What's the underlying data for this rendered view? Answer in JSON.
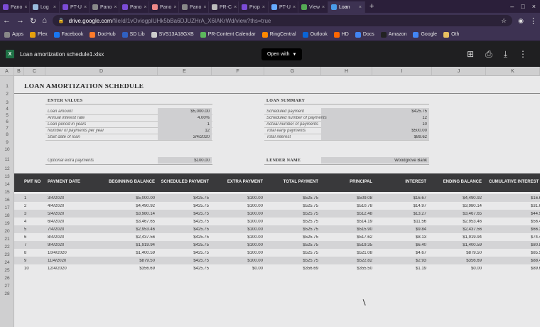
{
  "browser": {
    "tabs": [
      {
        "title": "Pano",
        "color": "#7b4bd6"
      },
      {
        "title": "Log",
        "color": "#9bd"
      },
      {
        "title": "PT-U",
        "color": "#7b4bd6"
      },
      {
        "title": "Pano",
        "color": "#888"
      },
      {
        "title": "Pano",
        "color": "#7b4bd6"
      },
      {
        "title": "Pano",
        "color": "#e88"
      },
      {
        "title": "Pano",
        "color": "#888"
      },
      {
        "title": "PR-C",
        "color": "#bbb"
      },
      {
        "title": "Prop",
        "color": "#7b4bd6"
      },
      {
        "title": "PT-U",
        "color": "#6af"
      },
      {
        "title": "View",
        "color": "#5a5"
      },
      {
        "title": "Loan",
        "color": "#4a9be8",
        "active": true
      }
    ],
    "new_tab_symbol": "+",
    "url_host": "drive.google.com",
    "url_path": "/file/d/1vOviogpIUHk5bBa6DJUZHrA_X6IAKrWd/view?ths=true",
    "bookmarks": [
      {
        "label": "Apps",
        "color": "#888"
      },
      {
        "label": "Plex",
        "color": "#e5a00d"
      },
      {
        "label": "Facebook",
        "color": "#1877f2"
      },
      {
        "label": "DocHub",
        "color": "#ff7b2b"
      },
      {
        "label": "SD Lib",
        "color": "#3060c0"
      },
      {
        "label": "SVS13A18GXB",
        "color": "#ccc"
      },
      {
        "label": "PR-Content Calendar",
        "color": "#5cb85c"
      },
      {
        "label": "RingCentral",
        "color": "#f80"
      },
      {
        "label": "Outlook",
        "color": "#0a64d6"
      },
      {
        "label": "HD",
        "color": "#f60"
      },
      {
        "label": "Docs",
        "color": "#4285f4"
      },
      {
        "label": "Amazon",
        "color": "#222"
      },
      {
        "label": "Google",
        "color": "#4285f4"
      },
      {
        "label": "Oth",
        "color": "#e8c060"
      }
    ]
  },
  "viewer": {
    "file_name": "Loan amortization schedule1.xlsx",
    "open_with_label": "Open with"
  },
  "sheet": {
    "columns": [
      "A",
      "B",
      "C",
      "D",
      "E",
      "F",
      "G",
      "H",
      "I",
      "J",
      "K"
    ],
    "rows": [
      "1",
      "2",
      "3",
      "4",
      "5",
      "6",
      "7",
      "8",
      "9",
      "10",
      "11",
      "12",
      "13",
      "14",
      "15",
      "16",
      "17",
      "18",
      "19",
      "20",
      "21",
      "22",
      "23",
      "24",
      "25",
      "26",
      "27",
      "28"
    ],
    "title": "LOAN AMORTIZATION SCHEDULE",
    "enter_values": {
      "heading": "ENTER VALUES",
      "items": [
        {
          "label": "Loan amount",
          "value": "$5,000.00"
        },
        {
          "label": "Annual interest rate",
          "value": "4.00%"
        },
        {
          "label": "Loan period in years",
          "value": "1"
        },
        {
          "label": "Number of payments per year",
          "value": "12"
        },
        {
          "label": "Start date of loan",
          "value": "3/4/2020"
        }
      ],
      "optional_label": "Optional extra payments",
      "optional_value": "$100.00"
    },
    "loan_summary": {
      "heading": "LOAN SUMMARY",
      "items": [
        {
          "label": "Scheduled payment",
          "value": "$425.75"
        },
        {
          "label": "Scheduled number of payments",
          "value": "12"
        },
        {
          "label": "Actual number of payments",
          "value": "10"
        },
        {
          "label": "Total early payments",
          "value": "$500.00"
        },
        {
          "label": "Total interest",
          "value": "$89.62"
        }
      ],
      "lender_label": "LENDER NAME",
      "lender_value": "Woodgrove Bank"
    },
    "table_headers": [
      "PMT NO",
      "PAYMENT DATE",
      "BEGINNING BALANCE",
      "SCHEDULED PAYMENT",
      "EXTRA PAYMENT",
      "TOTAL PAYMENT",
      "PRINCIPAL",
      "INTEREST",
      "ENDING BALANCE",
      "CUMULATIVE INTEREST"
    ],
    "table_rows": [
      [
        "1",
        "3/4/2020",
        "$5,000.00",
        "$425.75",
        "$100.00",
        "$525.75",
        "$509.08",
        "$16.67",
        "$4,490.92",
        "$16.6"
      ],
      [
        "2",
        "4/4/2020",
        "$4,490.92",
        "$425.75",
        "$100.00",
        "$525.75",
        "$510.78",
        "$14.97",
        "$3,980.14",
        "$31.6"
      ],
      [
        "3",
        "5/4/2020",
        "$3,980.14",
        "$425.75",
        "$100.00",
        "$525.75",
        "$512.48",
        "$13.27",
        "$3,467.65",
        "$44.9"
      ],
      [
        "4",
        "6/4/2020",
        "$3,467.65",
        "$425.75",
        "$100.00",
        "$525.75",
        "$514.19",
        "$11.56",
        "$2,953.46",
        "$56.4"
      ],
      [
        "5",
        "7/4/2020",
        "$2,953.46",
        "$425.75",
        "$100.00",
        "$525.75",
        "$515.90",
        "$9.84",
        "$2,437.56",
        "$66.3"
      ],
      [
        "6",
        "8/4/2020",
        "$2,437.56",
        "$425.75",
        "$100.00",
        "$525.75",
        "$517.62",
        "$8.13",
        "$1,919.94",
        "$74.4"
      ],
      [
        "7",
        "9/4/2020",
        "$1,919.94",
        "$425.75",
        "$100.00",
        "$525.75",
        "$519.35",
        "$6.40",
        "$1,400.59",
        "$80.8"
      ],
      [
        "8",
        "10/4/2020",
        "$1,400.59",
        "$425.75",
        "$100.00",
        "$525.75",
        "$521.08",
        "$4.67",
        "$879.50",
        "$85.5"
      ],
      [
        "9",
        "11/4/2020",
        "$879.50",
        "$425.75",
        "$100.00",
        "$525.75",
        "$522.82",
        "$2.93",
        "$356.69",
        "$88.4"
      ],
      [
        "10",
        "12/4/2020",
        "$356.69",
        "$425.75",
        "$0.00",
        "$356.69",
        "$355.50",
        "$1.19",
        "$0.00",
        "$89.6"
      ]
    ]
  }
}
